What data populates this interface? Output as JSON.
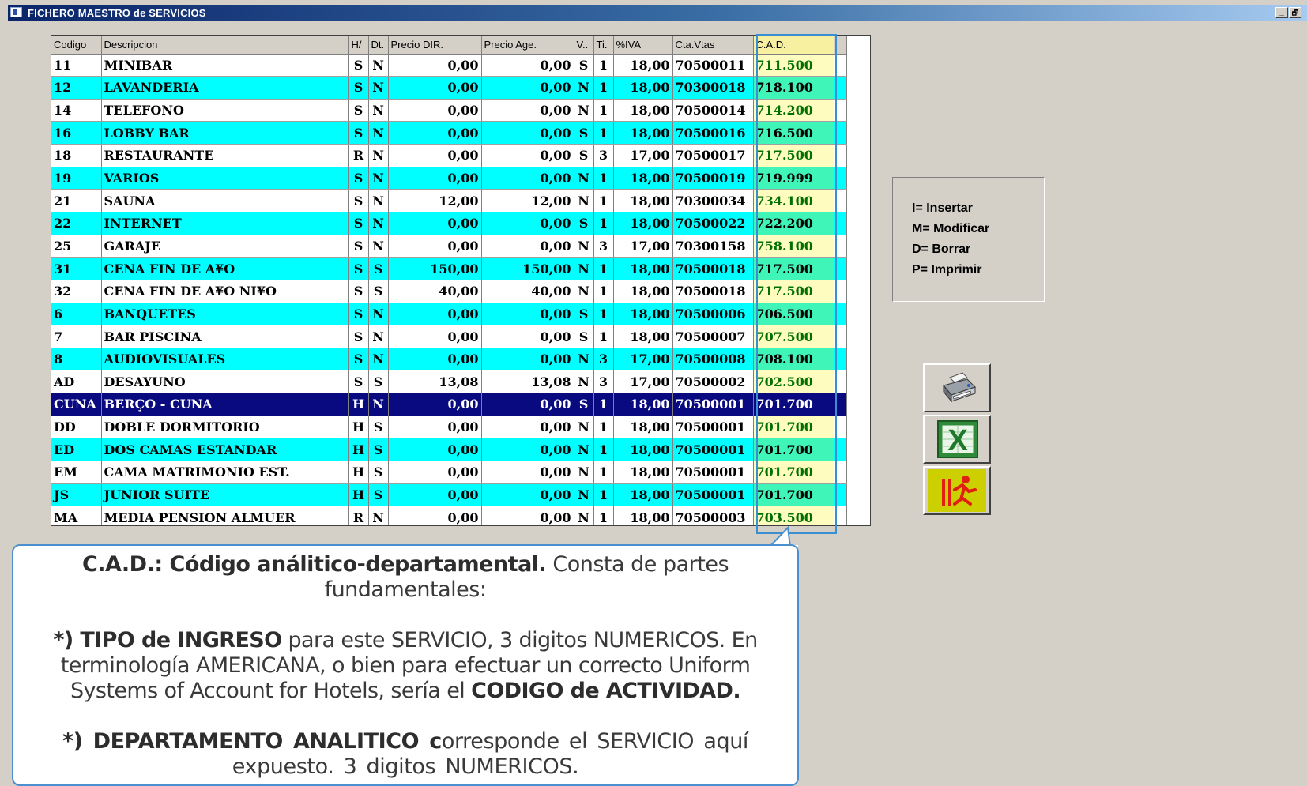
{
  "window": {
    "title": "FICHERO MAESTRO de SERVICIOS",
    "minimize_label": "_",
    "restore_label": "🗗"
  },
  "grid": {
    "columns": [
      "Codigo",
      "Descripcion",
      "H/",
      "Dt.",
      "Precio DIR.",
      "Precio Age.",
      "V..",
      "Ti.",
      "%IVA",
      "Cta.Vtas",
      "C.A.D."
    ],
    "rows": [
      [
        "11",
        "MINIBAR",
        "S",
        "N",
        "0,00",
        "0,00",
        "S",
        "1",
        "18,00",
        "70500011",
        "711.500"
      ],
      [
        "12",
        "LAVANDERIA",
        "S",
        "N",
        "0,00",
        "0,00",
        "N",
        "1",
        "18,00",
        "70300018",
        "718.100"
      ],
      [
        "14",
        "TELEFONO",
        "S",
        "N",
        "0,00",
        "0,00",
        "N",
        "1",
        "18,00",
        "70500014",
        "714.200"
      ],
      [
        "16",
        "LOBBY BAR",
        "S",
        "N",
        "0,00",
        "0,00",
        "S",
        "1",
        "18,00",
        "70500016",
        "716.500"
      ],
      [
        "18",
        "RESTAURANTE",
        "R",
        "N",
        "0,00",
        "0,00",
        "S",
        "3",
        "17,00",
        "70500017",
        "717.500"
      ],
      [
        "19",
        "VARIOS",
        "S",
        "N",
        "0,00",
        "0,00",
        "N",
        "1",
        "18,00",
        "70500019",
        "719.999"
      ],
      [
        "21",
        "SAUNA",
        "S",
        "N",
        "12,00",
        "12,00",
        "N",
        "1",
        "18,00",
        "70300034",
        "734.100"
      ],
      [
        "22",
        "INTERNET",
        "S",
        "N",
        "0,00",
        "0,00",
        "S",
        "1",
        "18,00",
        "70500022",
        "722.200"
      ],
      [
        "25",
        "GARAJE",
        "S",
        "N",
        "0,00",
        "0,00",
        "N",
        "3",
        "17,00",
        "70300158",
        "758.100"
      ],
      [
        "31",
        "CENA FIN DE A¥O",
        "S",
        "S",
        "150,00",
        "150,00",
        "N",
        "1",
        "18,00",
        "70500018",
        "717.500"
      ],
      [
        "32",
        "CENA FIN DE A¥O NI¥O",
        "S",
        "S",
        "40,00",
        "40,00",
        "N",
        "1",
        "18,00",
        "70500018",
        "717.500"
      ],
      [
        "6",
        "BANQUETES",
        "S",
        "N",
        "0,00",
        "0,00",
        "S",
        "1",
        "18,00",
        "70500006",
        "706.500"
      ],
      [
        "7",
        "BAR PISCINA",
        "S",
        "N",
        "0,00",
        "0,00",
        "S",
        "1",
        "18,00",
        "70500007",
        "707.500"
      ],
      [
        "8",
        "AUDIOVISUALES",
        "S",
        "N",
        "0,00",
        "0,00",
        "N",
        "3",
        "17,00",
        "70500008",
        "708.100"
      ],
      [
        "AD",
        "DESAYUNO",
        "S",
        "S",
        "13,08",
        "13,08",
        "N",
        "3",
        "17,00",
        "70500002",
        "702.500"
      ],
      [
        "CUNA",
        "BERÇO - CUNA",
        "H",
        "N",
        "0,00",
        "0,00",
        "S",
        "1",
        "18,00",
        "70500001",
        "701.700"
      ],
      [
        "DD",
        "DOBLE DORMITORIO",
        "H",
        "S",
        "0,00",
        "0,00",
        "N",
        "1",
        "18,00",
        "70500001",
        "701.700"
      ],
      [
        "ED",
        "DOS CAMAS ESTANDAR",
        "H",
        "S",
        "0,00",
        "0,00",
        "N",
        "1",
        "18,00",
        "70500001",
        "701.700"
      ],
      [
        "EM",
        "CAMA MATRIMONIO EST.",
        "H",
        "S",
        "0,00",
        "0,00",
        "N",
        "1",
        "18,00",
        "70500001",
        "701.700"
      ],
      [
        "JS",
        "JUNIOR SUITE",
        "H",
        "S",
        "0,00",
        "0,00",
        "N",
        "1",
        "18,00",
        "70500001",
        "701.700"
      ],
      [
        "MA",
        "MEDIA PENSION ALMUER",
        "R",
        "N",
        "0,00",
        "0,00",
        "N",
        "1",
        "18,00",
        "70500003",
        "703.500"
      ]
    ],
    "selected_row": 15,
    "scroll_up": "▲",
    "scroll_down": "▼"
  },
  "legend": {
    "items": [
      "I= Insertar",
      "M= Modificar",
      "D= Borrar",
      "P= Imprimir"
    ]
  },
  "buttons": {
    "print_icon": "printer-icon",
    "excel_icon": "excel-icon",
    "exit_icon": "exit-icon",
    "excel_letter": "X"
  },
  "callout": {
    "p1_bold": "C.A.D.: Código análitico-departamental.",
    "p1_rest": " Consta de partes fundamentales:",
    "p2_bold": "*) TIPO  de  INGRESO",
    "p2_mid": " para este SERVICIO,  3 digitos NUMERICOS. En terminología AMERICANA, o bien para efectuar un correcto Uniform Systems of Account for Hotels, sería el ",
    "p2_bold2": "CODIGO de ACTIVIDAD.",
    "p3_bold": "*) DEPARTAMENTO  ANALITICO  c",
    "p3_rest": "orresponde el SERVICIO aquí expuesto. 3 digitos NUMERICOS."
  },
  "colors": {
    "alt_row": "#00ffff",
    "selected_row": "#0a0a80",
    "cad_column": "#fffcc0",
    "callout_border": "#4a90d0"
  }
}
